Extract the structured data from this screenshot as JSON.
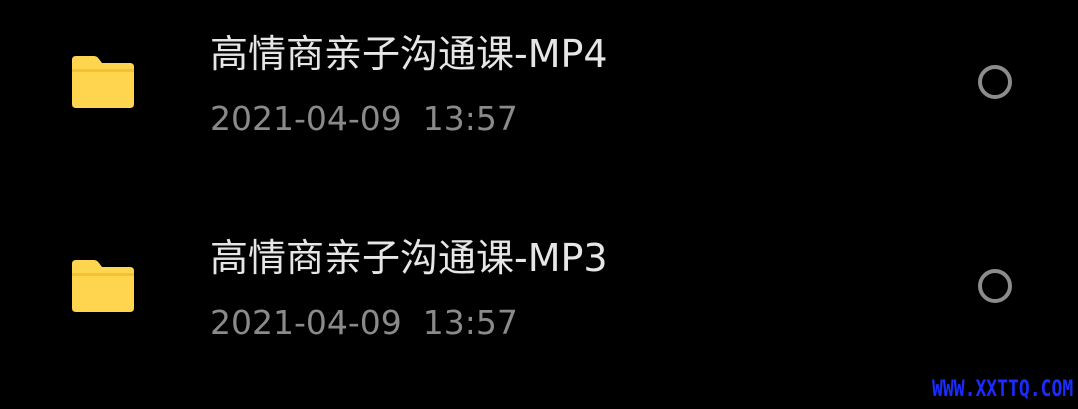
{
  "files": [
    {
      "name": "高情商亲子沟通课-MP4",
      "date": "2021-04-09  13:57",
      "icon": "folder-icon",
      "selected": false
    },
    {
      "name": "高情商亲子沟通课-MP3",
      "date": "2021-04-09  13:57",
      "icon": "folder-icon",
      "selected": false
    }
  ],
  "watermark": "WWW.XXTTQ.COM",
  "colors": {
    "background": "#000000",
    "folder": "#FFD54F",
    "name_text": "#E6E6E6",
    "date_text": "#8A8A8A",
    "radio_border": "#8C8C8C",
    "watermark": "#1A2CFF"
  }
}
